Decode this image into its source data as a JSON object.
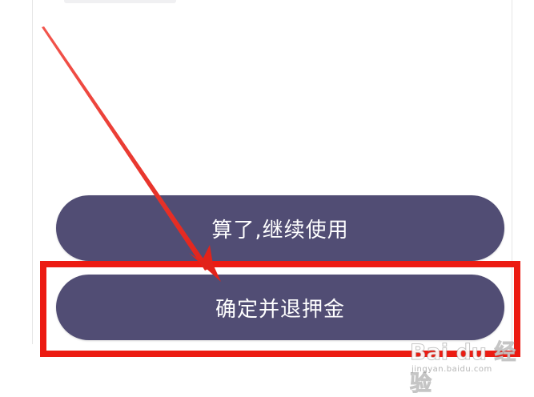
{
  "dialog": {
    "continue_label": "算了,继续使用",
    "confirm_label": "确定并退押金"
  },
  "watermark": {
    "logo_text": "Bai du 经验",
    "url_text": "jingyan.baidu.com"
  },
  "colors": {
    "button_bg": "#514d74",
    "button_text": "#ffffff",
    "annotation_red": "#ec1b12"
  }
}
